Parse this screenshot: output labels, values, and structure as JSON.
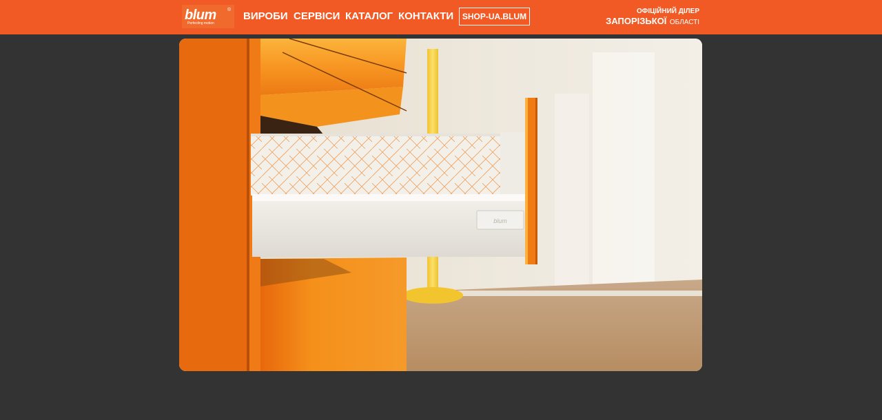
{
  "header": {
    "logo": {
      "wordmark": "blum",
      "registered": "®",
      "tagline": "Perfecting motion"
    },
    "nav": [
      {
        "label": "ВИРОБИ"
      },
      {
        "label": "СЕРВІСИ"
      },
      {
        "label": "КАТАЛОГ"
      },
      {
        "label": "КОНТАКТИ"
      }
    ],
    "shop_button": "SHOP-UA.BLUM",
    "dealer": {
      "line1": "ОФІЦІЙНИЙ ДІЛЕР",
      "region": "ЗАПОРІЗЬКОЇ",
      "suffix": "ОБЛАСТІ"
    }
  },
  "hero": {
    "image": "orange-drawer-cabinet-photo",
    "drawer_brand": "blum"
  },
  "colors": {
    "brand_orange": "#f15a24",
    "background": "#333333"
  }
}
